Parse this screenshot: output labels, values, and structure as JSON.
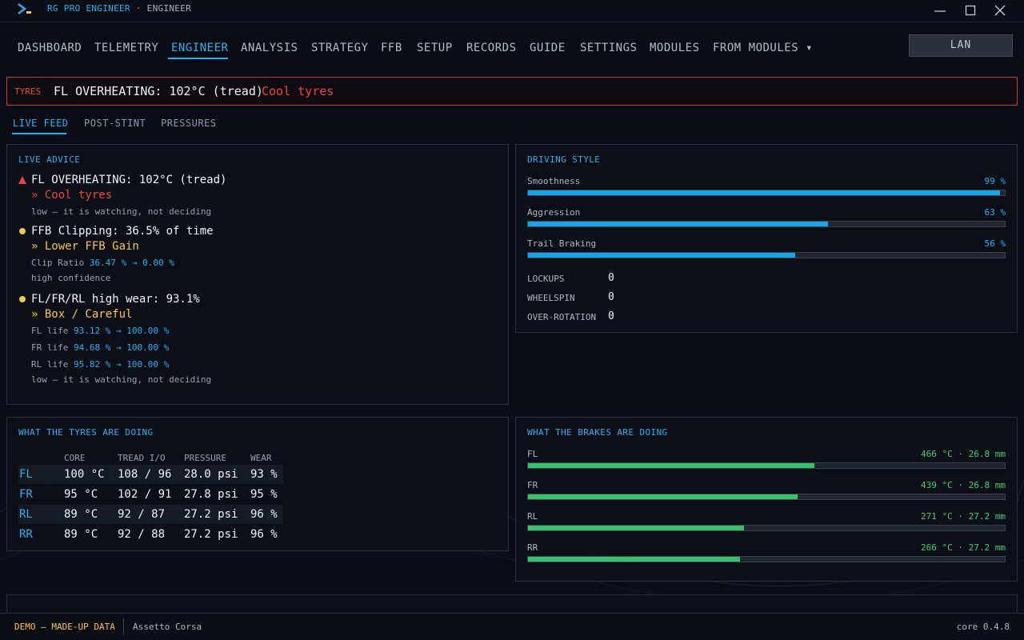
{
  "app": {
    "title": "RG PRO ENGINEER",
    "separator": "·",
    "subtitle": "ENGINEER"
  },
  "nav": {
    "items": [
      {
        "label": "DASHBOARD",
        "active": false
      },
      {
        "label": "TELEMETRY",
        "active": false
      },
      {
        "label": "ENGINEER",
        "active": true
      },
      {
        "label": "ANALYSIS",
        "active": false
      },
      {
        "label": "STRATEGY",
        "active": false
      },
      {
        "label": "FFB",
        "active": false
      },
      {
        "label": "SETUP",
        "active": false
      },
      {
        "label": "RECORDS",
        "active": false
      },
      {
        "label": "GUIDE",
        "active": false
      },
      {
        "label": "SETTINGS",
        "active": false
      },
      {
        "label": "MODULES",
        "active": false
      },
      {
        "label": "FROM MODULES ▾",
        "active": false
      }
    ],
    "lan_button": "LAN"
  },
  "alert": {
    "tag": "TYRES",
    "message": "FL OVERHEATING: 102°C (tread)",
    "action": "Cool tyres"
  },
  "subtabs": [
    {
      "label": "LIVE FEED",
      "active": true
    },
    {
      "label": "POST-STINT",
      "active": false
    },
    {
      "label": "PRESSURES",
      "active": false
    }
  ],
  "live_advice": {
    "title": "LIVE ADVICE",
    "items": [
      {
        "severity": "critical",
        "headline": "FL OVERHEATING: 102°C (tread)",
        "recommendation": "»  Cool tyres",
        "details": [],
        "confidence": "low — it is watching, not deciding"
      },
      {
        "severity": "warning",
        "headline": "FFB Clipping: 36.5% of time",
        "recommendation": "»  Lower FFB Gain",
        "details": [
          {
            "label": "Clip Ratio",
            "value": "36.47 % → 0.00 %"
          }
        ],
        "confidence": "high confidence"
      },
      {
        "severity": "warning",
        "headline": "FL/FR/RL high wear: 93.1%",
        "recommendation": "»  Box / Careful",
        "details": [
          {
            "label": "FL life",
            "value": "93.12 % → 100.00 %"
          },
          {
            "label": "FR life",
            "value": "94.68 % → 100.00 %"
          },
          {
            "label": "RL life",
            "value": "95.82 % → 100.00 %"
          }
        ],
        "confidence": "low — it is watching, not deciding"
      }
    ]
  },
  "driving_style": {
    "title": "DRIVING STYLE",
    "metrics": [
      {
        "label": "Smoothness",
        "value_text": "99 %",
        "value": 99
      },
      {
        "label": "Aggression",
        "value_text": "63 %",
        "value": 63
      },
      {
        "label": "Trail Braking",
        "value_text": "56 %",
        "value": 56
      }
    ],
    "counts": [
      {
        "label": "LOCKUPS",
        "value": "0"
      },
      {
        "label": "WHEELSPIN",
        "value": "0"
      },
      {
        "label": "OVER-ROTATION",
        "value": "0"
      }
    ]
  },
  "tyres": {
    "title": "WHAT THE TYRES ARE DOING",
    "columns": [
      "CORE",
      "TREAD I/O",
      "PRESSURE",
      "WEAR"
    ],
    "rows": [
      {
        "corner": "FL",
        "core": "100 °C",
        "tread": "108 / 96",
        "pressure": "28.0 psi",
        "wear": "93 %"
      },
      {
        "corner": "FR",
        "core": "95 °C",
        "tread": "102 / 91",
        "pressure": "27.8 psi",
        "wear": "95 %"
      },
      {
        "corner": "RL",
        "core": "89 °C",
        "tread": "92 / 87",
        "pressure": "27.2 psi",
        "wear": "96 %"
      },
      {
        "corner": "RR",
        "core": "89 °C",
        "tread": "92 / 88",
        "pressure": "27.2 psi",
        "wear": "96 %"
      }
    ]
  },
  "brakes": {
    "title": "WHAT THE BRAKES ARE DOING",
    "rows": [
      {
        "corner": "FL",
        "value_text": "466 °C · 26.8 mm",
        "level": 0.6
      },
      {
        "corner": "FR",
        "value_text": "439 °C · 26.8 mm",
        "level": 0.565
      },
      {
        "corner": "RL",
        "value_text": "271 °C · 27.2 mm",
        "level": 0.453
      },
      {
        "corner": "RR",
        "value_text": "266 °C · 27.2 mm",
        "level": 0.445
      }
    ]
  },
  "footer": {
    "mode": "DEMO — MADE-UP DATA",
    "game": "Assetto Corsa",
    "version": "core 0.4.8"
  },
  "colors": {
    "accent": "#2ab0f0",
    "critical": "#ef4444",
    "warning": "#f2c94c",
    "brake": "#35c46d"
  }
}
